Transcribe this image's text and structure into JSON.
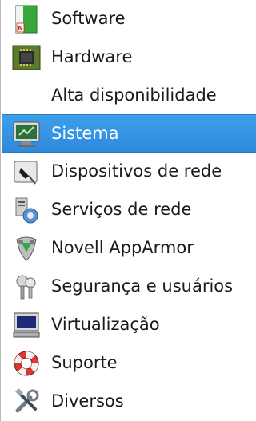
{
  "menu": {
    "items": [
      {
        "label": "Software",
        "icon": "software-package-icon",
        "selected": false
      },
      {
        "label": "Hardware",
        "icon": "hardware-chip-icon",
        "selected": false
      },
      {
        "label": "Alta disponibilidade",
        "icon": "",
        "selected": false
      },
      {
        "label": "Sistema",
        "icon": "system-monitor-icon",
        "selected": true
      },
      {
        "label": "Dispositivos de rede",
        "icon": "network-card-icon",
        "selected": false
      },
      {
        "label": "Serviços de rede",
        "icon": "network-services-icon",
        "selected": false
      },
      {
        "label": "Novell AppArmor",
        "icon": "apparmor-shield-icon",
        "selected": false
      },
      {
        "label": "Segurança e usuários",
        "icon": "security-users-icon",
        "selected": false
      },
      {
        "label": "Virtualização",
        "icon": "virtualization-monitor-icon",
        "selected": false
      },
      {
        "label": "Suporte",
        "icon": "lifebuoy-icon",
        "selected": false
      },
      {
        "label": "Diversos",
        "icon": "tools-icon",
        "selected": false
      }
    ],
    "selection_color": "#3495e4"
  }
}
